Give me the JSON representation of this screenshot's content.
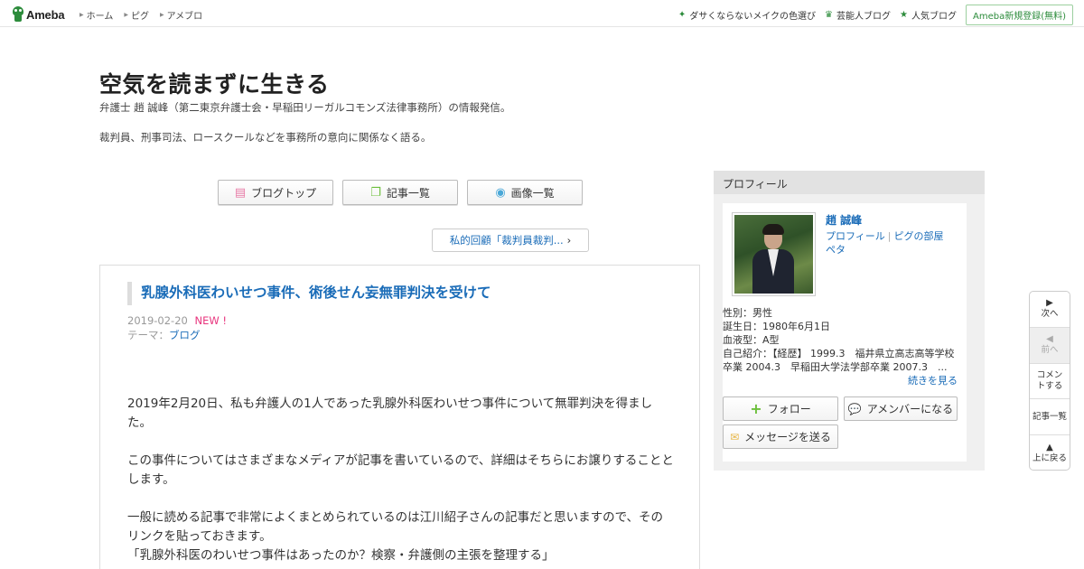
{
  "header": {
    "logo": "Ameba",
    "nav": [
      "ホーム",
      "ピグ",
      "アメブロ"
    ],
    "right_links": [
      {
        "icon": "sparkle-icon",
        "label": "ダサくならないメイクの色選び"
      },
      {
        "icon": "crown-icon",
        "label": "芸能人ブログ"
      },
      {
        "icon": "star-icon",
        "label": "人気ブログ"
      }
    ],
    "register": "Ameba新規登録(無料)"
  },
  "blog": {
    "title": "空気を読まずに生きる",
    "desc1": "弁護士 趙 誠峰（第二東京弁護士会・早稲田リーガルコモンズ法律事務所）の情報発信。",
    "desc2": "裁判員、刑事司法、ロースクールなどを事務所の意向に関係なく語る。"
  },
  "nav_buttons": {
    "top": "ブログトップ",
    "list": "記事一覧",
    "images": "画像一覧"
  },
  "prev_article": "私的回顧「裁判員裁判...",
  "article": {
    "title": "乳腺外科医わいせつ事件、術後せん妄無罪判決を受けて",
    "date": "2019-02-20",
    "new_badge": "NEW !",
    "theme_label": "テーマ：",
    "theme": "ブログ",
    "p1": "2019年2月20日、私も弁護人の1人であった乳腺外科医わいせつ事件について無罪判決を得ました。",
    "p2": "この事件についてはさまざまなメディアが記事を書いているので、詳細はそちらにお譲りすることとします。",
    "p3": "一般に読める記事で非常によくまとめられているのは江川紹子さんの記事だと思いますので、そのリンクを貼っておきます。",
    "p4": "「乳腺外科医のわいせつ事件はあったのか？検察・弁護側の主張を整理する」"
  },
  "profile": {
    "header": "プロフィール",
    "name": "趙 誠峰",
    "link1": "プロフィール",
    "link2": "ピグの部屋",
    "link3": "ペタ",
    "gender": "性別：男性",
    "birthday": "誕生日：1980年6月1日",
    "blood": "血液型：A型",
    "intro": "自己紹介：【経歴】 1999.3　福井県立高志高等学校卒業 2004.3　早稲田大学法学部卒業 2007.3　...",
    "more": "続きを見る",
    "follow": "フォロー",
    "member": "アメンバーになる",
    "message": "メッセージを送る"
  },
  "float_nav": {
    "next": "次へ",
    "prev": "前へ",
    "comment": "コメントする",
    "list": "記事一覧",
    "top": "上に戻る"
  }
}
